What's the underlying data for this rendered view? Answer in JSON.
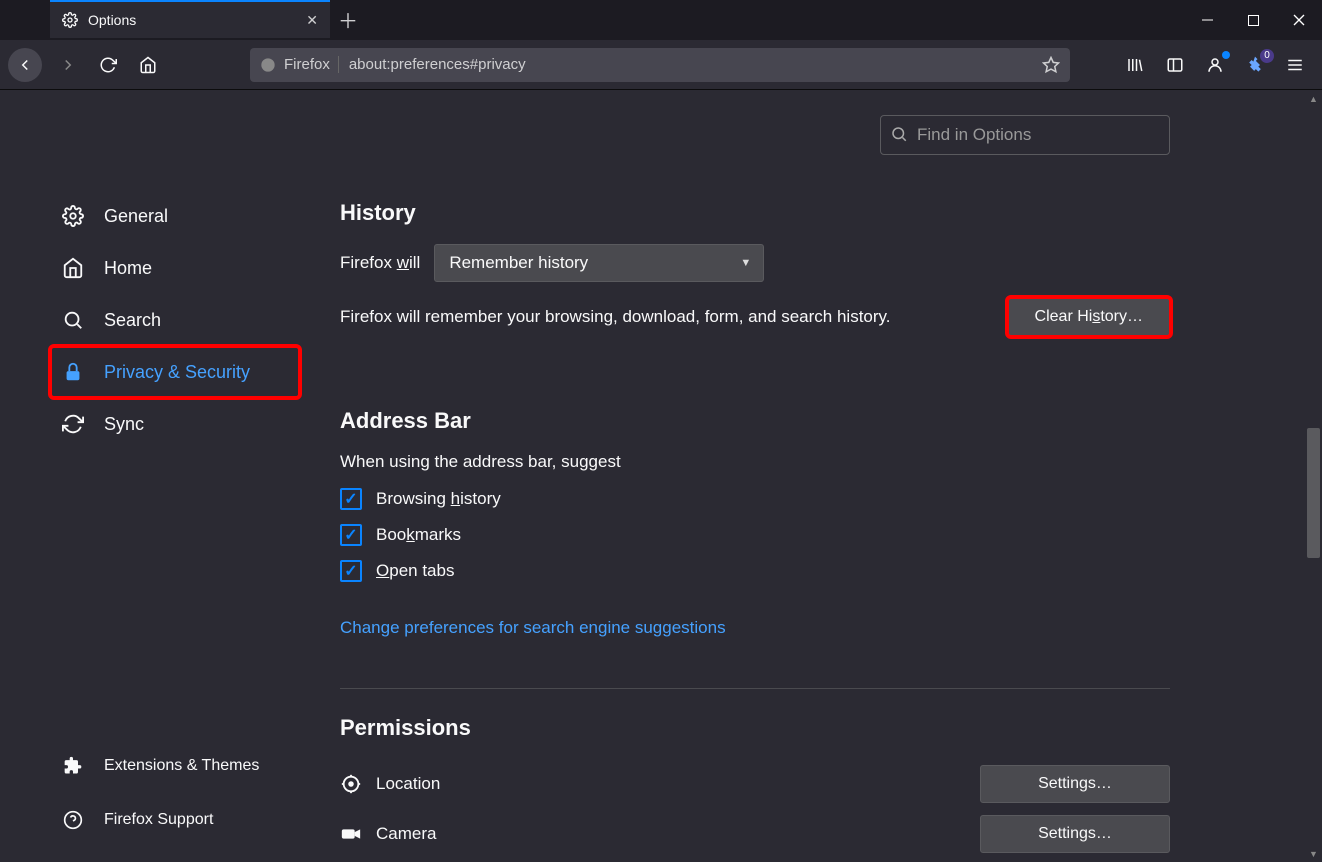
{
  "tab": {
    "title": "Options"
  },
  "navbar": {
    "identity_label": "Firefox",
    "url": "about:preferences#privacy",
    "badge_count": "0"
  },
  "search": {
    "placeholder": "Find in Options"
  },
  "sidebar": {
    "items": [
      {
        "label": "General"
      },
      {
        "label": "Home"
      },
      {
        "label": "Search"
      },
      {
        "label": "Privacy & Security"
      },
      {
        "label": "Sync"
      }
    ],
    "bottom": [
      {
        "label": "Extensions & Themes"
      },
      {
        "label": "Firefox Support"
      }
    ]
  },
  "history": {
    "heading": "History",
    "will_prefix": "Firefox ",
    "will_word": "w",
    "will_suffix": "ill",
    "select_value": "Remember history",
    "description": "Firefox will remember your browsing, download, form, and search history.",
    "clear_prefix": "Clear Hi",
    "clear_letter": "s",
    "clear_suffix": "tory…"
  },
  "address": {
    "heading": "Address Bar",
    "subheading": "When using the address bar, suggest",
    "checks": {
      "history_pre": "Browsing ",
      "history_u": "h",
      "history_post": "istory",
      "bookmarks_pre": "Boo",
      "bookmarks_u": "k",
      "bookmarks_post": "marks",
      "opentabs_u": "O",
      "opentabs_post": "pen tabs"
    },
    "link": "Change preferences for search engine suggestions"
  },
  "permissions": {
    "heading": "Permissions",
    "items": [
      {
        "label": "Location",
        "button": "Settings…"
      },
      {
        "label": "Camera",
        "button": "Settings…"
      }
    ]
  }
}
